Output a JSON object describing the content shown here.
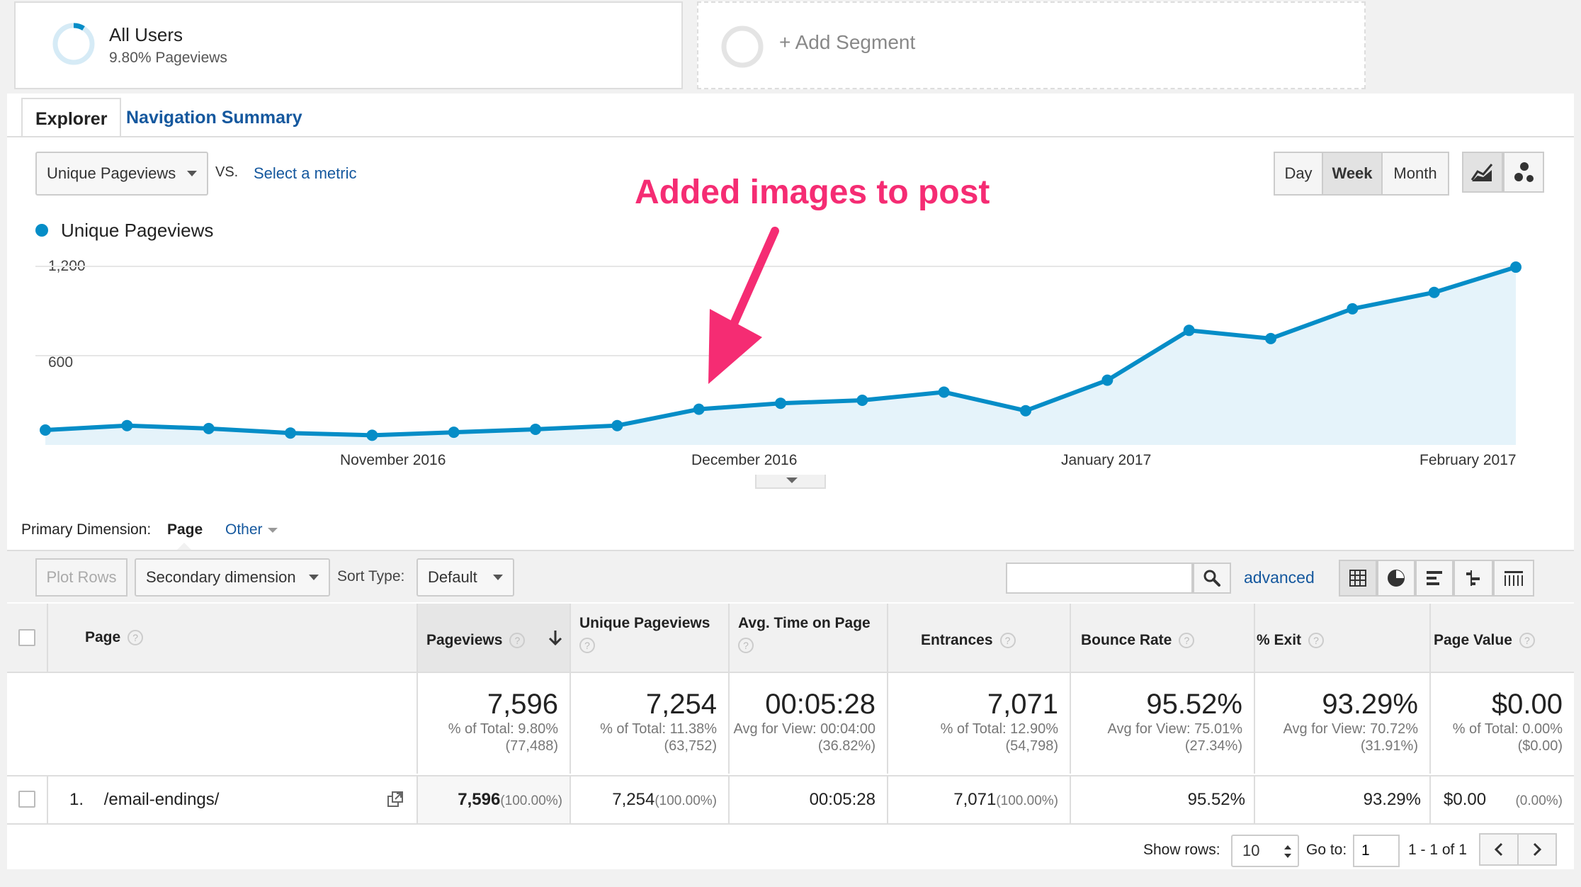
{
  "segments": {
    "active": {
      "title": "All Users",
      "subtitle": "9.80% Pageviews"
    },
    "add_label": "+ Add Segment"
  },
  "tabs": [
    {
      "label": "Explorer"
    },
    {
      "label": "Navigation Summary"
    }
  ],
  "metric_select": {
    "value": "Unique Pageviews"
  },
  "vs_label": "VS.",
  "select_metric": "Select a metric",
  "granularity": {
    "day": "Day",
    "week": "Week",
    "month": "Month",
    "selected": "Week"
  },
  "icons": {
    "line_chart": "line-chart-icon",
    "motion_chart": "motion-chart-icon",
    "search": "search-icon",
    "data_view": "data-table-icon",
    "percentage_view": "pie-chart-icon",
    "performance_view": "bar-chart-icon",
    "comparison_view": "comparison-icon",
    "term_cloud_view": "pivot-icon",
    "help": "help-icon",
    "open_link": "external-link-icon"
  },
  "annotation": "Added images to post",
  "colors": {
    "series": "#058dc7",
    "annotation": "#f52c73",
    "link": "#15589e"
  },
  "chart_data": {
    "type": "area",
    "series": [
      {
        "name": "Unique Pageviews",
        "values": [
          100,
          130,
          110,
          80,
          65,
          85,
          105,
          130,
          240,
          280,
          300,
          355,
          230,
          435,
          770,
          715,
          915,
          1025,
          1195
        ]
      }
    ],
    "ylim": [
      0,
      1200
    ],
    "yticks": [
      "1,200",
      "600"
    ],
    "xtick_labels": [
      "November 2016",
      "December 2016",
      "January 2017",
      "February 2017"
    ],
    "grid": true
  },
  "dimension": {
    "label": "Primary Dimension:",
    "selected": "Page",
    "other": "Other"
  },
  "toolbar": {
    "plot_rows": "Plot Rows",
    "secondary": "Secondary dimension",
    "sort_label": "Sort Type:",
    "sort_value": "Default",
    "search_value": "",
    "advanced": "advanced"
  },
  "table": {
    "headers": [
      "Page",
      "Pageviews",
      "Unique Pageviews",
      "Avg. Time on Page",
      "Entrances",
      "Bounce Rate",
      "% Exit",
      "Page Value"
    ],
    "totals": [
      {
        "big": "7,596",
        "l1": "% of Total: 9.80%",
        "l2": "(77,488)"
      },
      {
        "big": "7,254",
        "l1": "% of Total: 11.38%",
        "l2": "(63,752)"
      },
      {
        "big": "00:05:28",
        "l1": "Avg for View: 00:04:00",
        "l2": "(36.82%)"
      },
      {
        "big": "7,071",
        "l1": "% of Total: 12.90%",
        "l2": "(54,798)"
      },
      {
        "big": "95.52%",
        "l1": "Avg for View: 75.01%",
        "l2": "(27.34%)"
      },
      {
        "big": "93.29%",
        "l1": "Avg for View: 70.72%",
        "l2": "(31.91%)"
      },
      {
        "big": "$0.00",
        "l1": "% of Total: 0.00%",
        "l2": "($0.00)"
      }
    ],
    "rows": [
      {
        "index": "1.",
        "page": "/email-endings/",
        "pageviews": "7,596",
        "pageviews_pct": "(100.00%)",
        "unique": "7,254",
        "unique_pct": "(100.00%)",
        "avg_time": "00:05:28",
        "entrances": "7,071",
        "entrances_pct": "(100.00%)",
        "bounce": "95.52%",
        "exit": "93.29%",
        "value": "$0.00",
        "value_pct": "(0.00%)"
      }
    ]
  },
  "pagination": {
    "show_rows_label": "Show rows:",
    "show_rows_value": "10",
    "goto_label": "Go to:",
    "goto_value": "1",
    "range": "1 - 1 of 1"
  }
}
